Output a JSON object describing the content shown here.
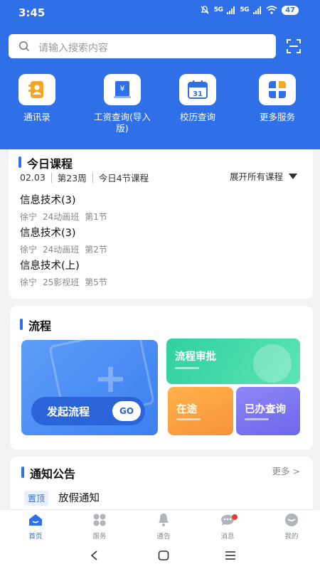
{
  "status": {
    "time": "3:45",
    "signal1": "5G",
    "signal2": "5G",
    "battery": "47"
  },
  "search": {
    "placeholder": "请输入搜索内容"
  },
  "quick_actions": [
    {
      "label": "通讯录",
      "icon": "contacts-icon"
    },
    {
      "label": "工资查询(导入版)",
      "icon": "salary-icon"
    },
    {
      "label": "校历查询",
      "icon": "calendar-icon",
      "day": "31"
    },
    {
      "label": "更多服务",
      "icon": "more-services-icon"
    }
  ],
  "courses": {
    "title": "今日课程",
    "date": "02.03",
    "week": "第23周",
    "count": "今日4节课程",
    "expand": "展开所有课程",
    "items": [
      {
        "name": "信息技术(3)",
        "teacher": "徐宁",
        "class": "24动画班",
        "period": "第1节"
      },
      {
        "name": "信息技术(3)",
        "teacher": "徐宁",
        "class": "24动画班",
        "period": "第2节"
      },
      {
        "name": "信息技术(上)",
        "teacher": "徐宁",
        "class": "25影视班",
        "period": "第5节"
      }
    ]
  },
  "flow": {
    "title": "流程",
    "start": "发起流程",
    "go": "GO",
    "approve": "流程审批",
    "ontheway": "在途",
    "done": "已办查询"
  },
  "notice": {
    "title": "通知公告",
    "more": "更多 >",
    "tag": "置顶",
    "item": "放假通知"
  },
  "tabs": [
    {
      "label": "首页"
    },
    {
      "label": "服务"
    },
    {
      "label": "通告"
    },
    {
      "label": "消息"
    },
    {
      "label": "我的"
    }
  ],
  "colors": {
    "primary": "#2f6fe8",
    "badge": "#e53935"
  }
}
